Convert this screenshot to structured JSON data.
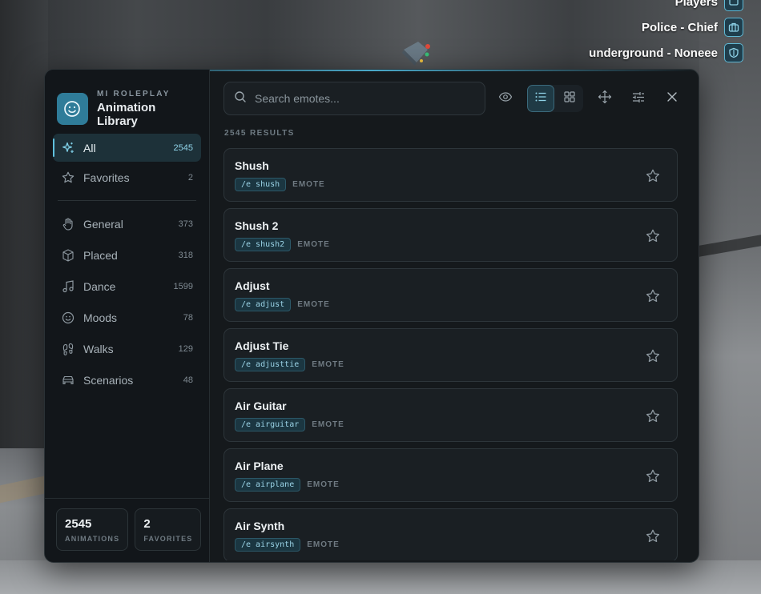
{
  "hud": {
    "players_label": "Players",
    "job_label": "Police - Chief",
    "gang_label": "underground - Noneee"
  },
  "sidebar": {
    "brand_subtitle": "MI ROLEPLAY",
    "brand_title": "Animation Library",
    "primary": [
      {
        "label": "All",
        "count": "2545",
        "icon": "sparkle-icon"
      },
      {
        "label": "Favorites",
        "count": "2",
        "icon": "star-icon"
      }
    ],
    "categories": [
      {
        "label": "General",
        "count": "373",
        "icon": "hand-icon"
      },
      {
        "label": "Placed",
        "count": "318",
        "icon": "box-icon"
      },
      {
        "label": "Dance",
        "count": "1599",
        "icon": "music-note-icon"
      },
      {
        "label": "Moods",
        "count": "78",
        "icon": "smiley-icon"
      },
      {
        "label": "Walks",
        "count": "129",
        "icon": "footprints-icon"
      },
      {
        "label": "Scenarios",
        "count": "48",
        "icon": "car-icon"
      }
    ],
    "stats": [
      {
        "value": "2545",
        "label": "ANIMATIONS"
      },
      {
        "value": "2",
        "label": "FAVORITES"
      }
    ]
  },
  "toolbar": {
    "search_placeholder": "Search emotes...",
    "search_value": ""
  },
  "results_label": "2545 RESULTS",
  "emotes": [
    {
      "name": "Shush",
      "command": "/e shush",
      "type": "EMOTE"
    },
    {
      "name": "Shush 2",
      "command": "/e shush2",
      "type": "EMOTE"
    },
    {
      "name": "Adjust",
      "command": "/e adjust",
      "type": "EMOTE"
    },
    {
      "name": "Adjust Tie",
      "command": "/e adjusttie",
      "type": "EMOTE"
    },
    {
      "name": "Air Guitar",
      "command": "/e airguitar",
      "type": "EMOTE"
    },
    {
      "name": "Air Plane",
      "command": "/e airplane",
      "type": "EMOTE"
    },
    {
      "name": "Air Synth",
      "command": "/e airsynth",
      "type": "EMOTE"
    }
  ],
  "colors": {
    "accent": "#5fc0dd",
    "panel_bg": "#15191c",
    "brand_logo": "#2f7c99"
  }
}
